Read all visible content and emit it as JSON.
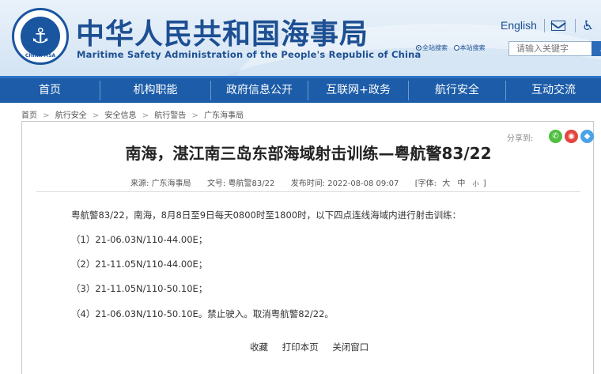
{
  "header": {
    "logo_text": "CHINA MSA",
    "title_cn": "中华人民共和国海事局",
    "title_en": "Maritime Safety Administration of the People's Republic of China",
    "english_link": "English",
    "search_scope_site": "全站搜索",
    "search_scope_sub": "本站搜索",
    "search_placeholder": "请输入关键字"
  },
  "nav": {
    "items": [
      "首页",
      "机构职能",
      "政府信息公开",
      "互联网+政务",
      "航行安全",
      "互动交流"
    ]
  },
  "breadcrumb": [
    "首页",
    "航行安全",
    "安全信息",
    "航行警告",
    "广东海事局"
  ],
  "share": {
    "label": "分享到:",
    "icons": [
      "wechat-icon",
      "weibo-icon",
      "qq-icon"
    ]
  },
  "article": {
    "title": "南海，湛江南三岛东部海域射击训练—粤航警83/22",
    "source_label": "来源:",
    "source": "广东海事局",
    "docno_label": "文号:",
    "docno": "粤航警83/22",
    "date_label": "发布时间:",
    "date": "2022-08-08 09:07",
    "font_label": "[字体:",
    "font_large": "大",
    "font_medium": "中",
    "font_small": "小",
    "font_close": "]",
    "paragraphs": [
      "粤航警83/22，南海，8月8日至9日每天0800时至1800时，以下四点连线海域内进行射击训练：",
      "（1）21-06.03N/110-44.00E；",
      "（2）21-11.05N/110-44.00E；",
      "（3）21-11.05N/110-50.10E；",
      "（4）21-06.03N/110-50.10E。禁止驶入。取消粤航警82/22。"
    ],
    "actions": [
      "收藏",
      "打印本页",
      "关闭窗口"
    ]
  },
  "colors": {
    "nav_bg": "#1c5ca8",
    "brand": "#1d4f92",
    "search_btn": "#2b6bb8",
    "wechat": "#4fbf40",
    "weibo": "#e2463e",
    "qq": "#4aa3e8"
  }
}
